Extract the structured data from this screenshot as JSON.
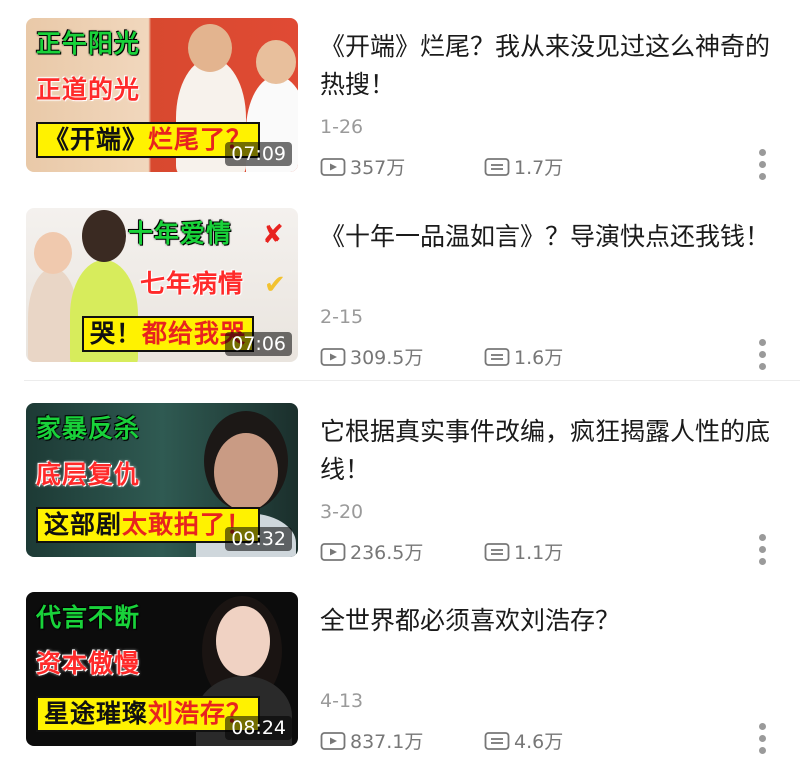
{
  "videos": [
    {
      "title": "《开端》烂尾？我从来没见过这么神奇的热搜！",
      "date": "1-26",
      "views": "357万",
      "comments": "1.7万",
      "duration": "07:09",
      "captions": [
        "正午阳光",
        "正道的光",
        "《开端》",
        "烂尾了？"
      ]
    },
    {
      "title": "《十年一品温如言》？导演快点还我钱！",
      "date": "2-15",
      "views": "309.5万",
      "comments": "1.6万",
      "duration": "07:06",
      "captions": [
        "十年爱情",
        "七年病情",
        "哭！",
        "都给我哭"
      ]
    },
    {
      "title": "它根据真实事件改编，疯狂揭露人性的底线！",
      "date": "3-20",
      "views": "236.5万",
      "comments": "1.1万",
      "duration": "09:32",
      "captions": [
        "家暴反杀",
        "底层复仇",
        "这部剧",
        "太敢拍了！"
      ]
    },
    {
      "title": "全世界都必须喜欢刘浩存？",
      "date": "4-13",
      "views": "837.1万",
      "comments": "4.6万",
      "duration": "08:24",
      "captions": [
        "代言不断",
        "资本傲慢",
        "星途璀璨",
        "刘浩存？"
      ]
    }
  ],
  "icons": {
    "play": "play-count-icon",
    "comment": "comment-icon",
    "more": "more-vertical-icon"
  },
  "colors": {
    "caption_green": "#19d23a",
    "caption_red": "#ff2a2a",
    "caption_yellow": "#fff200",
    "meta_gray": "#9a9a9a"
  }
}
